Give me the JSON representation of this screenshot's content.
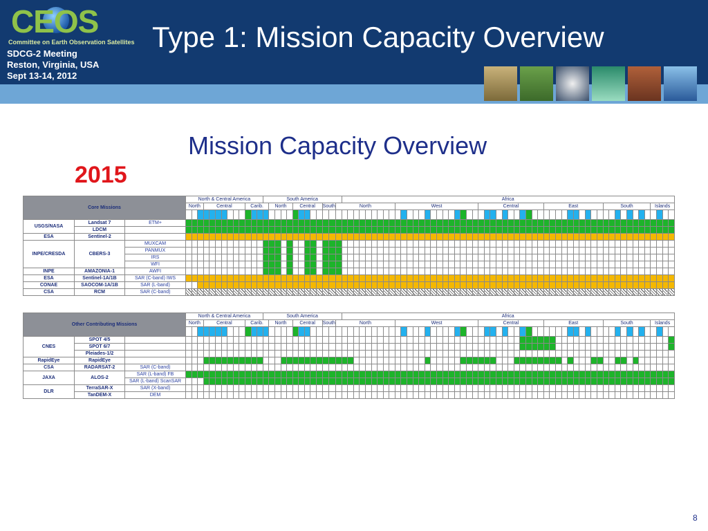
{
  "header": {
    "logo_text": "CEOS",
    "logo_subtitle": "Committee on Earth Observation Satellites",
    "meeting_lines": [
      "SDCG-2 Meeting",
      "Reston, Virginia, USA",
      "Sept 13-14, 2012"
    ],
    "title": "Type 1: Mission Capacity Overview"
  },
  "subtitle": "Mission Capacity Overview",
  "year": "2015",
  "page_number": "8",
  "regions": {
    "top": [
      "North & Central America",
      "South America",
      "Africa"
    ],
    "sub": [
      "North",
      "Central",
      "Carib.",
      "North",
      "Central",
      "South",
      "North",
      "West",
      "Central",
      "East",
      "South",
      "Islands"
    ]
  },
  "colors": {
    "header": "#123a70",
    "strip": "#6ea6d6",
    "available": "#1db42a",
    "planned": "#f5b800",
    "title_blue": "#1e2f8a",
    "year_red": "#e0161b"
  },
  "core_table": {
    "label": "Core Missions",
    "rows": [
      {
        "agency": "USGS/NASA",
        "mission": "Landsat 7",
        "instrument": "ETM+"
      },
      {
        "agency": "",
        "mission": "LDCM",
        "instrument": ""
      },
      {
        "agency": "ESA",
        "mission": "Sentinel-2",
        "instrument": ""
      },
      {
        "agency": "INPE/CRESDA",
        "mission": "CBERS-3",
        "instrument": "MUXCAM"
      },
      {
        "agency": "",
        "mission": "",
        "instrument": "PANMUX"
      },
      {
        "agency": "",
        "mission": "",
        "instrument": "IRS"
      },
      {
        "agency": "",
        "mission": "",
        "instrument": "WFI"
      },
      {
        "agency": "INPE",
        "mission": "AMAZONIA-1",
        "instrument": "AWFI"
      },
      {
        "agency": "ESA",
        "mission": "Sentinel-1A/1B",
        "instrument": "SAR (C-band) IWS"
      },
      {
        "agency": "CONAE",
        "mission": "SAOCOM-1A/1B",
        "instrument": "SAR (L-band)"
      },
      {
        "agency": "CSA",
        "mission": "RCM",
        "instrument": "SAR (C-band)"
      }
    ]
  },
  "other_table": {
    "label": "Other Contributing Missions",
    "rows": [
      {
        "agency": "CNES",
        "mission": "SPOT 4/5",
        "instrument": ""
      },
      {
        "agency": "",
        "mission": "SPOT 6/7",
        "instrument": ""
      },
      {
        "agency": "",
        "mission": "Pleiades-1/2",
        "instrument": ""
      },
      {
        "agency": "RapidEye",
        "mission": "RapidEye",
        "instrument": ""
      },
      {
        "agency": "CSA",
        "mission": "RADARSAT-2",
        "instrument": "SAR (C-band)"
      },
      {
        "agency": "JAXA",
        "mission": "ALOS-2",
        "instrument": "SAR (L-band) FB"
      },
      {
        "agency": "",
        "mission": "",
        "instrument": "SAR (L-band) ScanSAR"
      },
      {
        "agency": "DLR",
        "mission": "TerraSAR-X",
        "instrument": "SAR (X-band)"
      },
      {
        "agency": "",
        "mission": "TanDEM-X",
        "instrument": "DEM"
      }
    ]
  }
}
